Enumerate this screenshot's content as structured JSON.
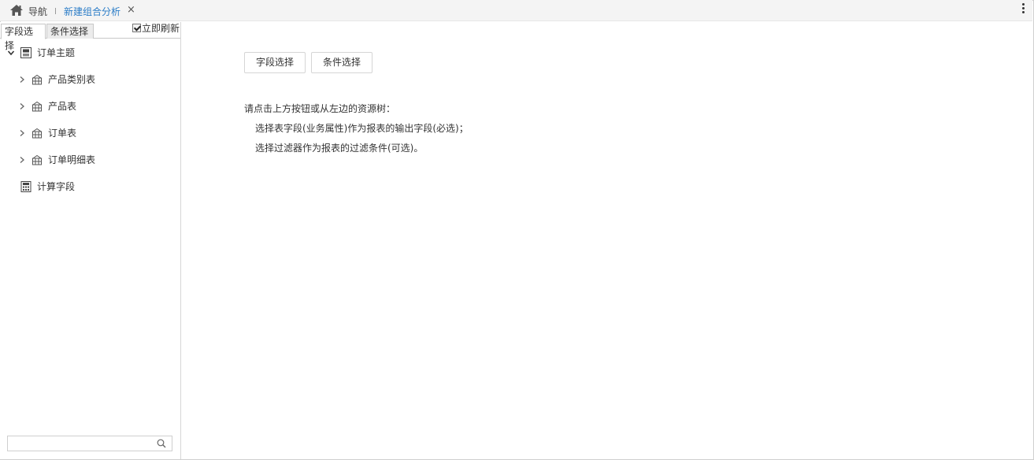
{
  "topbar": {
    "home_icon": "home-icon",
    "nav_label": "导航",
    "active_tab_label": "新建组合分析",
    "close_symbol": "×",
    "more_icon": "vertical-ellipsis-icon"
  },
  "left_panel": {
    "tabs": [
      {
        "label": "字段选择",
        "active": true
      },
      {
        "label": "条件选择",
        "active": false
      }
    ],
    "refresh_checkbox": {
      "label": "立即刷新",
      "checked": true
    },
    "tree": {
      "root": {
        "label": "订单主题",
        "expanded": true,
        "icon": "subject-icon"
      },
      "tables": [
        {
          "label": "产品类别表",
          "icon": "table-icon"
        },
        {
          "label": "产品表",
          "icon": "table-icon"
        },
        {
          "label": "订单表",
          "icon": "table-icon"
        },
        {
          "label": "订单明细表",
          "icon": "table-icon"
        }
      ],
      "calc": {
        "label": "计算字段",
        "icon": "calculator-icon"
      }
    },
    "search": {
      "placeholder": "",
      "icon": "search-icon"
    }
  },
  "main": {
    "buttons": [
      {
        "label": "字段选择"
      },
      {
        "label": "条件选择"
      }
    ],
    "hint_lines": [
      "请点击上方按钮或从左边的资源树：",
      "选择表字段(业务属性)作为报表的输出字段(必选)；",
      "选择过滤器作为报表的过滤条件(可选)。"
    ]
  },
  "colors": {
    "active_tab_text": "#2a7cc7",
    "topbar_bg": "#f4f4f4",
    "border": "#cfcfcf"
  }
}
